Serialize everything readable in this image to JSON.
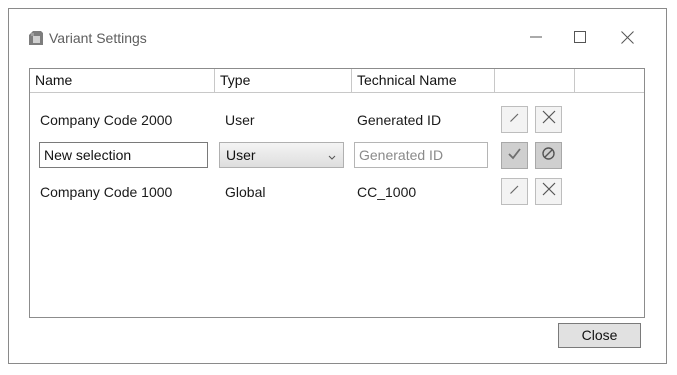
{
  "window": {
    "title": "Variant Settings",
    "icons": {
      "app": "variant-settings-icon",
      "minimize": "minimize-icon",
      "maximize": "maximize-icon",
      "close": "close-icon"
    }
  },
  "table": {
    "columns": [
      "Name",
      "Type",
      "Technical Name"
    ],
    "rows": [
      {
        "name": "Company Code 2000",
        "type": "User",
        "technical_name": "Generated ID",
        "actions": [
          "edit-icon",
          "delete-icon"
        ]
      },
      {
        "name": "New selection",
        "type": "User",
        "technical_name_placeholder": "Generated ID",
        "editing": true,
        "actions": [
          "confirm-icon",
          "cancel-icon"
        ]
      },
      {
        "name": "Company Code 1000",
        "type": "Global",
        "technical_name": "CC_1000",
        "actions": [
          "edit-icon",
          "delete-icon"
        ]
      }
    ]
  },
  "footer": {
    "close_label": "Close"
  },
  "colors": {
    "border": "#8c8c8c",
    "button_face": "#e1e1e1",
    "muted_text": "#8a8a8a"
  }
}
